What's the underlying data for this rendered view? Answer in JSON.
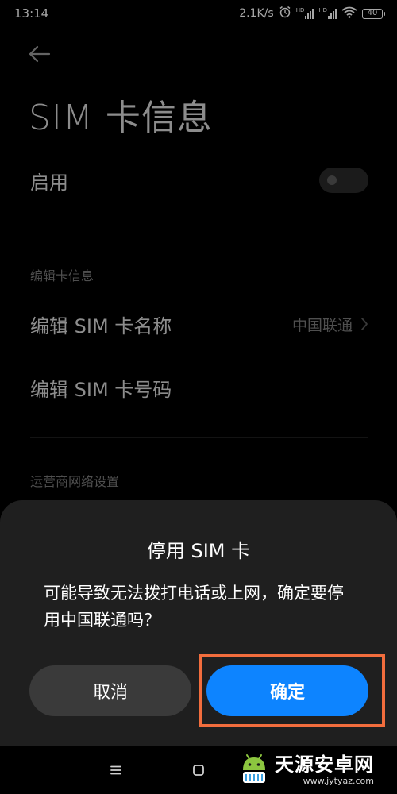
{
  "status_bar": {
    "time": "13:14",
    "network_speed": "2.1K/s",
    "alarm_icon": "alarm-icon",
    "signal_1_badge": "HD",
    "signal_2_badge": "HD",
    "wifi_icon": "wifi-icon",
    "battery": "40"
  },
  "header": {
    "back_icon": "back-arrow-icon",
    "title": "SIM 卡信息"
  },
  "settings": {
    "enable_label": "启用",
    "enable_on": false,
    "edit_section_title": "编辑卡信息",
    "edit_name_label": "编辑 SIM 卡名称",
    "edit_name_value": "中国联通",
    "edit_number_label": "编辑 SIM 卡号码",
    "carrier_section_title": "运营商网络设置"
  },
  "dialog": {
    "title": "停用 SIM 卡",
    "message": "可能导致无法拨打电话或上网，确定要停用中国联通吗？",
    "cancel_label": "取消",
    "confirm_label": "确定"
  },
  "nav_bar": {
    "menu_icon": "menu-icon",
    "home_icon": "home-icon"
  },
  "watermark": {
    "title": "天源安卓网",
    "url": "www.jytyaz.com"
  },
  "colors": {
    "background": "#000000",
    "dialog_background": "#1f1f1f",
    "confirm_button": "#0d84ff",
    "cancel_button": "#3a3a3a",
    "highlight": "#f26d3d",
    "secondary_text": "#7a7a7a"
  }
}
